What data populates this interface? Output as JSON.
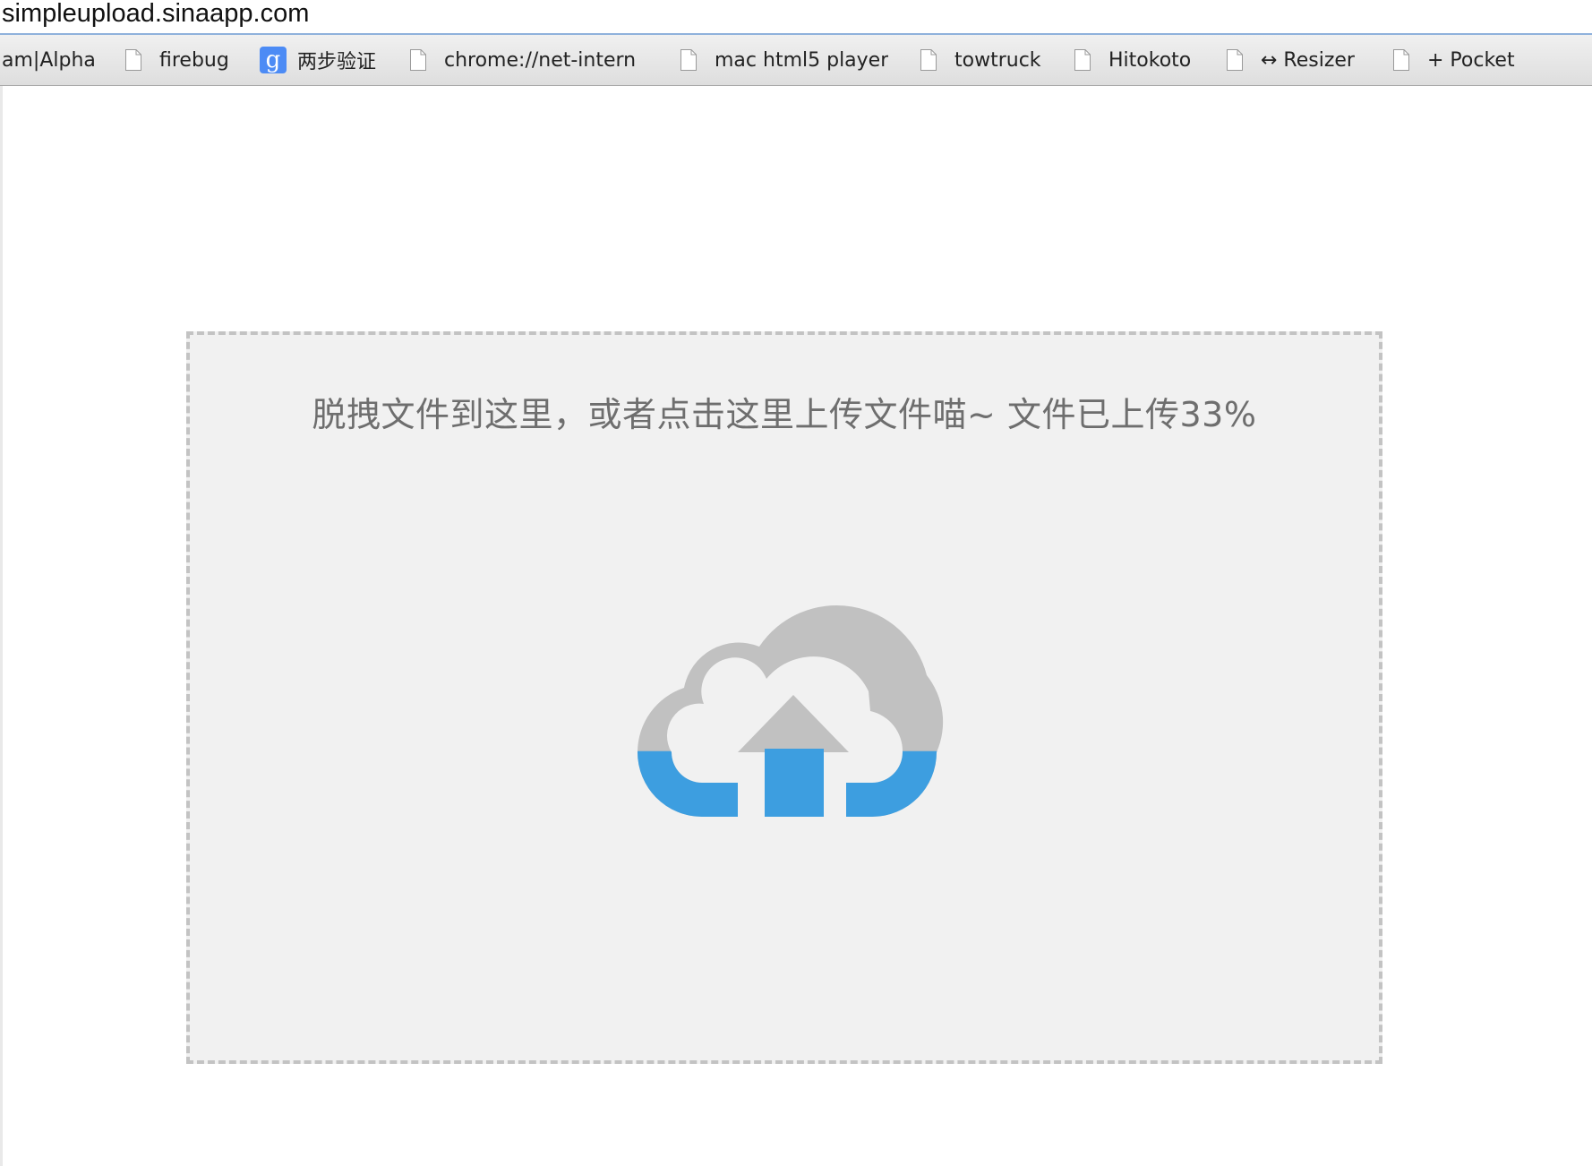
{
  "browser": {
    "url": "simpleupload.sinaapp.com",
    "bookmarks": [
      {
        "label": "am|Alpha",
        "icon": "none"
      },
      {
        "label": "firebug",
        "icon": "page-icon"
      },
      {
        "label": "两步验证",
        "icon": "google-icon",
        "icon_glyph": "g"
      },
      {
        "label": "chrome://net-intern",
        "icon": "page-icon"
      },
      {
        "label": "mac html5 player",
        "icon": "page-icon"
      },
      {
        "label": "towtruck",
        "icon": "page-icon"
      },
      {
        "label": "Hitokoto",
        "icon": "page-icon"
      },
      {
        "label": "↔ Resizer",
        "icon": "page-icon"
      },
      {
        "label": "+ Pocket",
        "icon": "page-icon"
      }
    ]
  },
  "upload": {
    "prompt": "脱拽文件到这里，或者点击这里上传文件喵~ 文件已上传33%",
    "progress_percent": 33,
    "icon": "cloud-upload-icon",
    "colors": {
      "cloud_empty": "#c1c1c1",
      "cloud_filled": "#3d9ee0",
      "zone_background": "#f1f1f1",
      "zone_border": "#c3c3c3",
      "text": "#6e6e6e"
    }
  }
}
